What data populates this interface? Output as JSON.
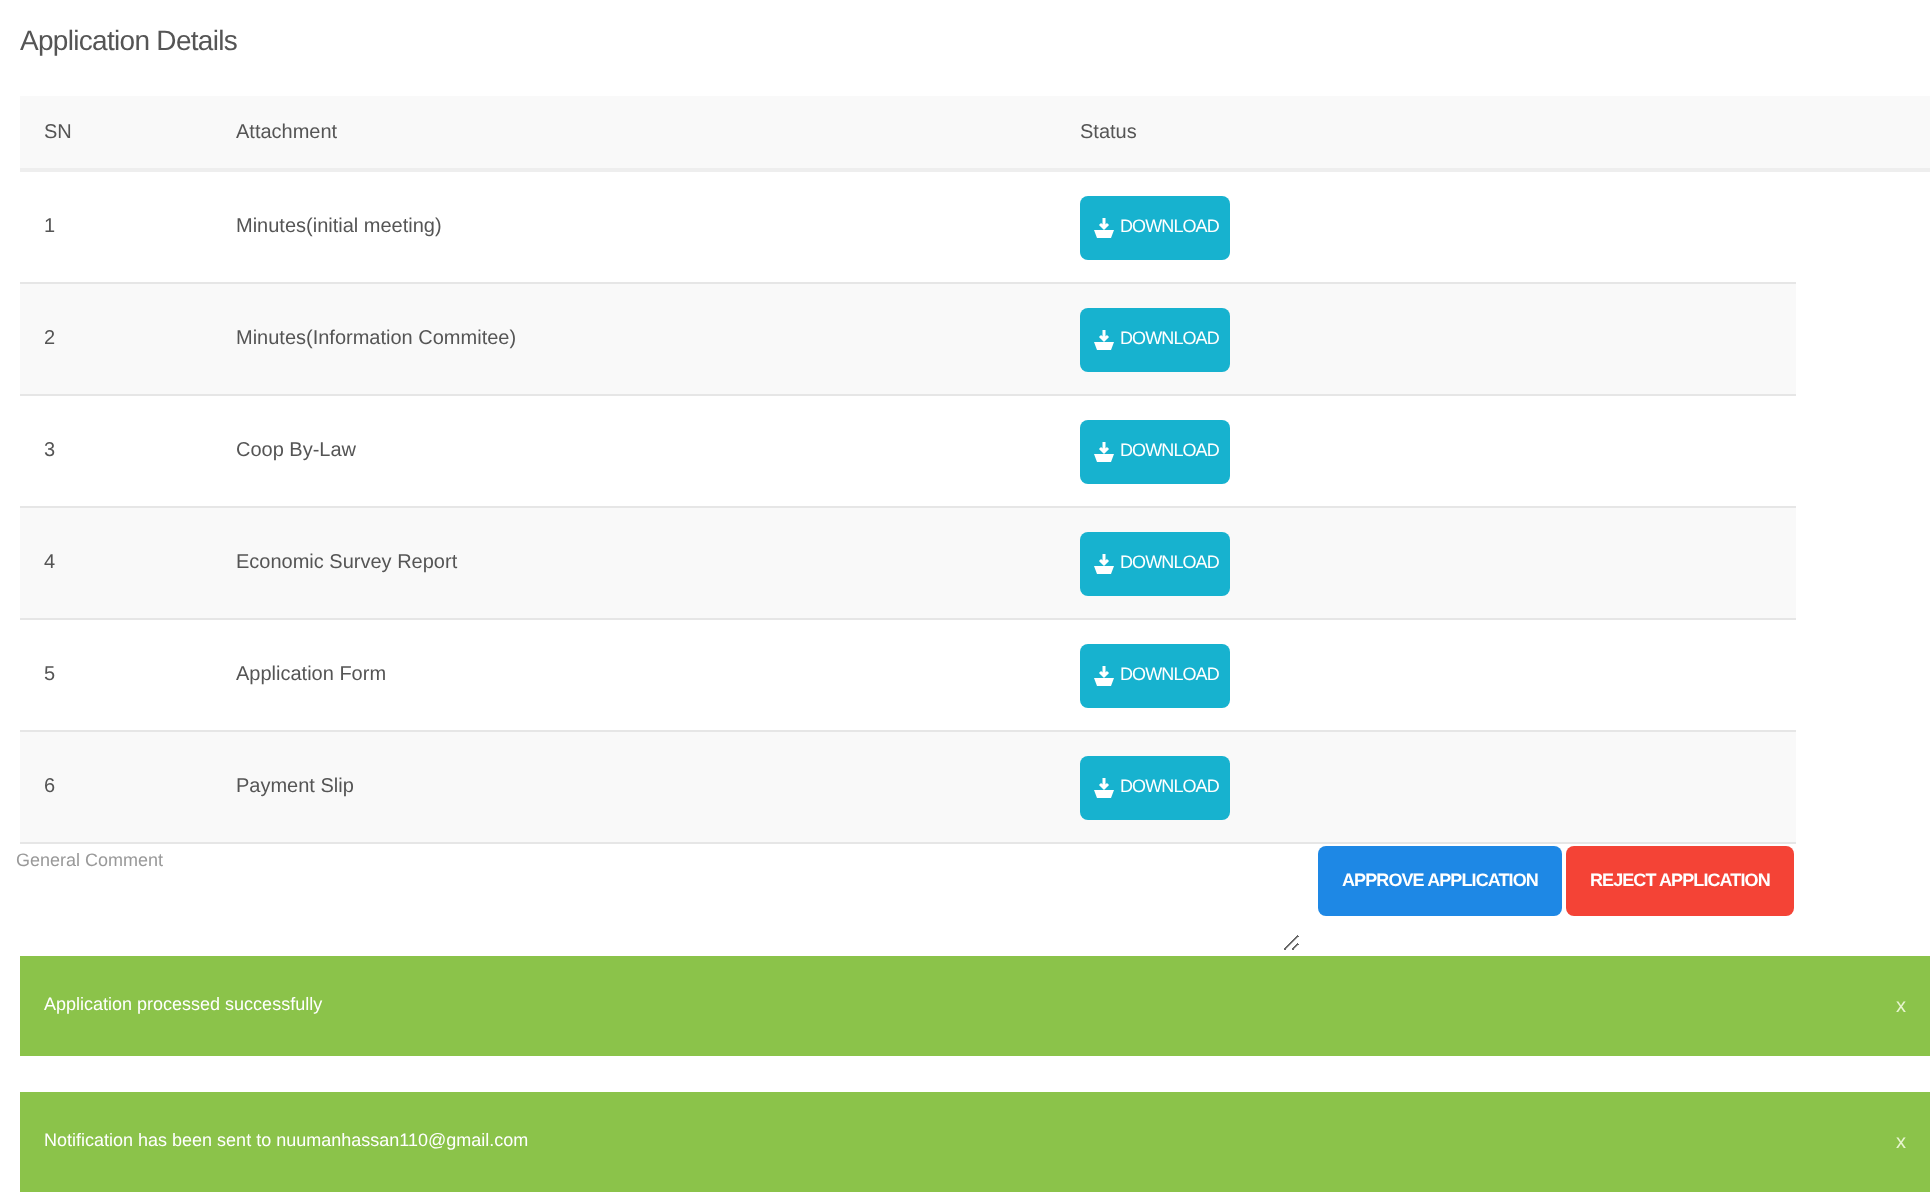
{
  "title": "Application Details",
  "table": {
    "columns": [
      "SN",
      "Attachment",
      "Status"
    ],
    "rows": [
      {
        "sn": "1",
        "attachment": "Minutes(initial meeting)",
        "action": "DOWNLOAD"
      },
      {
        "sn": "2",
        "attachment": "Minutes(Information Commitee)",
        "action": "DOWNLOAD"
      },
      {
        "sn": "3",
        "attachment": "Coop By-Law",
        "action": "DOWNLOAD"
      },
      {
        "sn": "4",
        "attachment": "Economic Survey Report",
        "action": "DOWNLOAD"
      },
      {
        "sn": "5",
        "attachment": "Application Form",
        "action": "DOWNLOAD"
      },
      {
        "sn": "6",
        "attachment": "Payment Slip",
        "action": "DOWNLOAD"
      }
    ]
  },
  "comment": {
    "placeholder": "General Comment"
  },
  "buttons": [
    {
      "kind": "approve",
      "label": "APPROVE APPLICATION"
    },
    {
      "kind": "reject",
      "label": "REJECT APPLICATION"
    }
  ],
  "alerts": [
    {
      "message": "Application processed successfully",
      "close": "x"
    },
    {
      "message": "Notification has been sent to nuumanhassan110@gmail.com",
      "close": "x"
    }
  ]
}
